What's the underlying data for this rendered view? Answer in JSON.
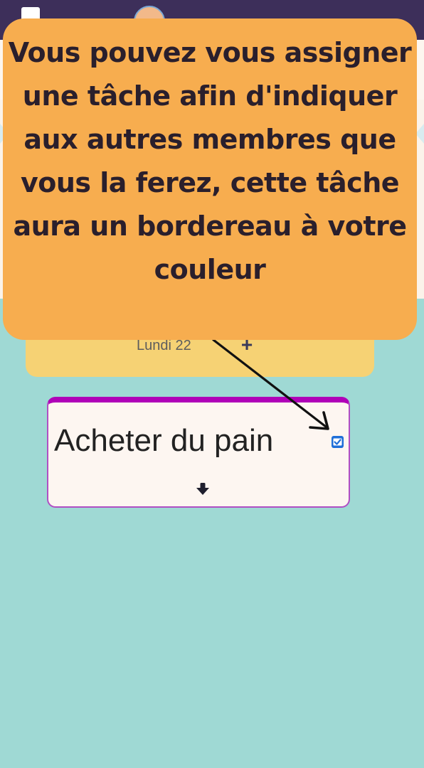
{
  "app": {
    "header_icons": [
      "app-logo-icon",
      "user-avatar-icon"
    ]
  },
  "calendar": {
    "day_label": "Lundi 22",
    "add_label": "+"
  },
  "task": {
    "title": "Acheter du pain",
    "assigned": true,
    "accent_color": "#b000b8"
  },
  "tutorial": {
    "text": "Vous pouvez vous assigner une tâche afin d'indiquer aux autres membres que vous la ferez, cette tâche aura un bordereau à votre couleur"
  },
  "colors": {
    "background": "#9fd9d4",
    "callout": "#f7ad4f",
    "day_card": "#f6d274",
    "checkbox": "#1f6fd8"
  }
}
